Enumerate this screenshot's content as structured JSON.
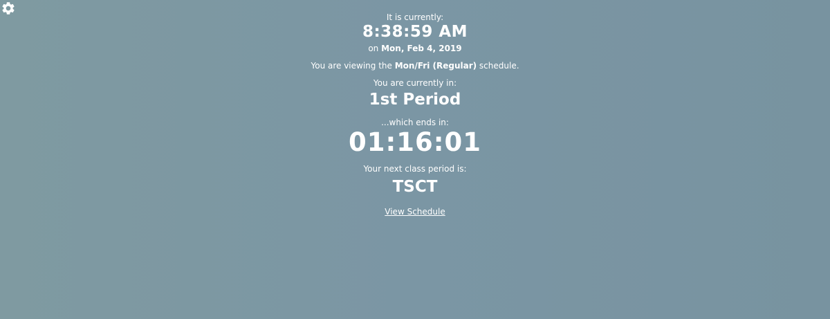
{
  "settings": {
    "icon": "gear-icon"
  },
  "clock": {
    "label": "It is currently:",
    "time": "8:38:59 AM",
    "date_prefix": "on",
    "date": "Mon, Feb 4, 2019"
  },
  "schedule": {
    "prefix": "You are viewing the",
    "name": "Mon/Fri (Regular)",
    "suffix": "schedule."
  },
  "current": {
    "label": "You are currently in:",
    "period": "1st Period"
  },
  "countdown": {
    "label": "...which ends in:",
    "value": "01:16:01"
  },
  "next": {
    "label": "Your next class period is:",
    "period": "TSCT"
  },
  "links": {
    "view_schedule": "View Schedule"
  }
}
